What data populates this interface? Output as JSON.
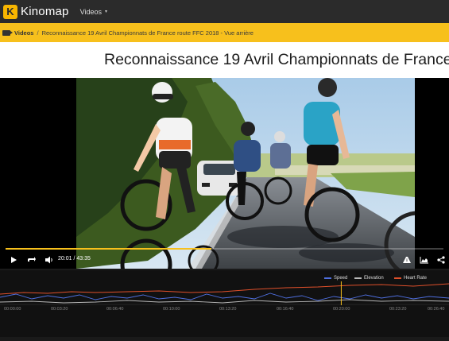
{
  "app": {
    "logo_letter": "K",
    "name": "Kinomap"
  },
  "nav": {
    "videos_label": "Videos",
    "caret": "▾"
  },
  "breadcrumb": {
    "root": "Videos",
    "separator": "/",
    "current": "Reconnaissance 19 Avril Championnats de France route FFC 2018 - Vue arrière"
  },
  "page": {
    "title": "Reconnaissance 19 Avril Championnats de France"
  },
  "player": {
    "current_time": "20:01",
    "total_time": "43:35",
    "time_separator": "/",
    "progress": 0.47
  },
  "graph": {
    "legend": [
      {
        "name": "Speed",
        "color": "#4f6fe0"
      },
      {
        "name": "Elevation",
        "color": "#b8b8b8"
      },
      {
        "name": "Heart Rate",
        "color": "#e0502b"
      }
    ],
    "ticks": [
      "00:00:00",
      "00:03:20",
      "00:06:40",
      "00:10:00",
      "00:13:20",
      "00:16:40",
      "00:20:00",
      "00:23:20",
      "00:26:40"
    ],
    "cursor_fraction": 0.76
  },
  "colors": {
    "accent": "#f7c01c",
    "topbar": "#2b2b2b"
  }
}
